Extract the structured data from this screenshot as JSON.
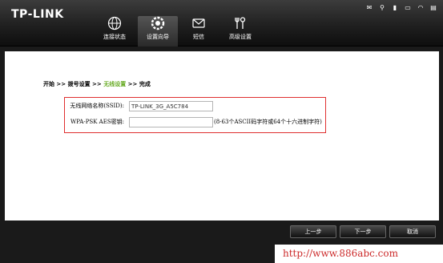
{
  "header": {
    "logo": "TP-LINK",
    "nav": [
      {
        "label": "连接状态",
        "icon": "globe-icon"
      },
      {
        "label": "设置向导",
        "icon": "settings-gear-icon",
        "active": true
      },
      {
        "label": "短信",
        "icon": "mail-icon"
      },
      {
        "label": "高级设置",
        "icon": "tools-icon"
      }
    ],
    "status_icons": [
      "mail-status-icon",
      "usb-icon",
      "signal-icon",
      "battery-icon",
      "wifi-icon",
      "menu-icon"
    ]
  },
  "breadcrumb": {
    "step1": "开始",
    "sep1": " >> ",
    "step2": "拨号设置",
    "sep2": " >> ",
    "step3": "无线设置",
    "sep3": " >> ",
    "step4": "完成"
  },
  "form": {
    "ssid_label": "无线网络名称(SSID):",
    "ssid_value": "TP-LINK_3G_A5C784",
    "wpa_label": "WPA-PSK AES密钥:",
    "wpa_value": "",
    "wpa_hint": "(8-63个ASCII码字符或64个十六进制字符)"
  },
  "buttons": {
    "prev": "上一步",
    "next": "下一步",
    "cancel": "取消"
  },
  "watermark": "http://www.886abc.com"
}
